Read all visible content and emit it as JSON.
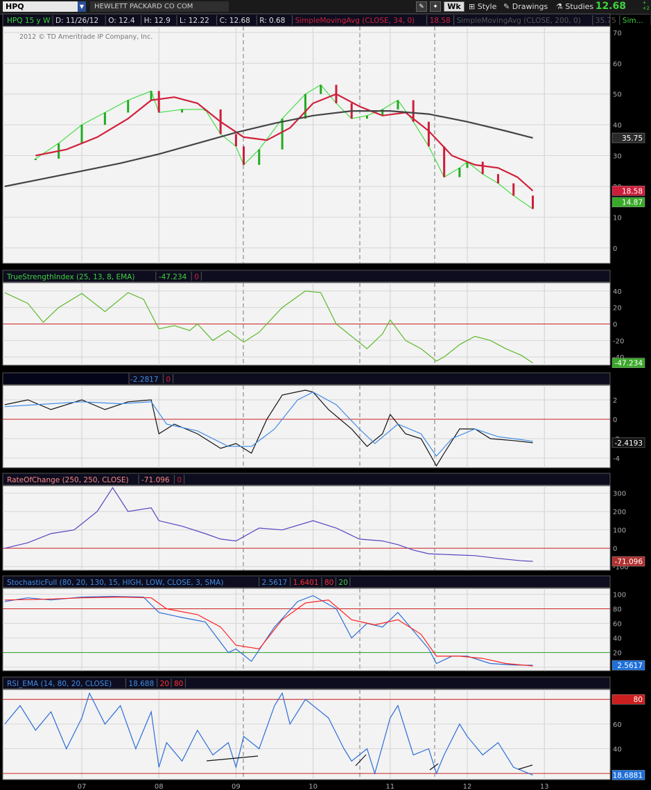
{
  "toolbar": {
    "symbol": "HPQ",
    "company": "HEWLETT PACKARD CO COM",
    "wk_label": "Wk",
    "style_label": "Style",
    "drawings_label": "Drawings",
    "studies_label": "Studies",
    "last_price": "12.68",
    "change_up": "+",
    "change_up2": "+2"
  },
  "price_panel": {
    "header": [
      {
        "text": "HPQ 15 y W",
        "color": "#3ed13e"
      },
      {
        "text": "D: 11/26/12",
        "color": "#dddddd"
      },
      {
        "text": "O: 12.4",
        "color": "#dddddd"
      },
      {
        "text": "H: 12.9",
        "color": "#dddddd"
      },
      {
        "text": "L: 12.22",
        "color": "#dddddd"
      },
      {
        "text": "C: 12.68",
        "color": "#dddddd"
      },
      {
        "text": "R: 0.68",
        "color": "#dddddd"
      },
      {
        "text": "SimpleMovingAvg (CLOSE, 34, 0)",
        "color": "#d0203a"
      },
      {
        "text": "18.58",
        "color": "#d0203a"
      },
      {
        "text": "SimpleMovingAvg (CLOSE, 200, 0)",
        "color": "#555555"
      },
      {
        "text": "35.75",
        "color": "#555555"
      },
      {
        "text": "Sim...",
        "color": "#3ed13e"
      }
    ],
    "copyright": "2012 © TD Ameritrade IP Company, Inc.",
    "badges": [
      {
        "text": "35.75",
        "bg": "#2a2a2a",
        "value": 35.75
      },
      {
        "text": "18.58",
        "bg": "#cc1e3a",
        "value": 18.58
      },
      {
        "text": "14.87",
        "bg": "#3aa82a",
        "value": 14.87
      }
    ]
  },
  "tsi_panel": {
    "header": [
      {
        "text": "TrueStrengthIndex (25, 13, 8, EMA)",
        "color": "#3ed13e"
      },
      {
        "text": "-47.234",
        "color": "#3ed13e"
      },
      {
        "text": "0",
        "color": "#d0203a"
      }
    ],
    "badge": "-47.234"
  },
  "macd_panel": {
    "header": [
      {
        "text": "-2.2817",
        "color": "#3f8ce6"
      },
      {
        "text": "0",
        "color": "#d0203a"
      }
    ],
    "badge": "-2.4193"
  },
  "roc_panel": {
    "header": [
      {
        "text": "RateOfChange (250, 250, CLOSE)",
        "color": "#ff8888"
      },
      {
        "text": "-71.096",
        "color": "#ff8888"
      },
      {
        "text": "0",
        "color": "#d0203a"
      }
    ],
    "badge": "-71.096"
  },
  "stoch_panel": {
    "header": [
      {
        "text": "StochasticFull (80, 20, 130, 15, HIGH, LOW, CLOSE, 3, SMA)",
        "color": "#3f8ce6"
      },
      {
        "text": "2.5617",
        "color": "#3f8ce6"
      },
      {
        "text": "1.6401",
        "color": "#ff3030"
      },
      {
        "text": "80",
        "color": "#ff3030"
      },
      {
        "text": "20",
        "color": "#3ed13e"
      }
    ],
    "badge": "2.5617"
  },
  "rsi_panel": {
    "header": [
      {
        "text": "RSI_EMA (14, 80, 20, CLOSE)",
        "color": "#3f8ce6"
      },
      {
        "text": "18.688",
        "color": "#3f8ce6"
      },
      {
        "text": "20",
        "color": "#ff3030"
      },
      {
        "text": "80",
        "color": "#ff3030"
      }
    ],
    "badges": [
      {
        "text": "80",
        "bg": "#cc1e1e",
        "value": 80
      },
      {
        "text": "18.6881",
        "bg": "#1e6fd9",
        "value": 18.688
      }
    ]
  },
  "chart_data": [
    {
      "type": "line",
      "title": "HPQ 15 y W",
      "x_ticks": [
        "07",
        "08",
        "09",
        "10",
        "11",
        "12",
        "13"
      ],
      "ylim": [
        -5,
        72
      ],
      "y_ticks": [
        0,
        10,
        20,
        30,
        40,
        50,
        60,
        70
      ],
      "series": [
        {
          "name": "HPQ",
          "color": "#44dd44",
          "x": [
            2006.4,
            2006.7,
            2007.0,
            2007.3,
            2007.6,
            2007.9,
            2008.0,
            2008.3,
            2008.6,
            2008.8,
            2009.0,
            2009.1,
            2009.3,
            2009.6,
            2009.9,
            2010.1,
            2010.3,
            2010.5,
            2010.7,
            2010.9,
            2011.1,
            2011.3,
            2011.5,
            2011.7,
            2011.9,
            2012.0,
            2012.2,
            2012.4,
            2012.6,
            2012.85
          ],
          "values": [
            29,
            34,
            40,
            44,
            48,
            51,
            44,
            45,
            45,
            37,
            33,
            27,
            32,
            42,
            50,
            53,
            47,
            42,
            43,
            45,
            48,
            41,
            33,
            23,
            26,
            28,
            24,
            21,
            17,
            12.68
          ]
        },
        {
          "name": "SimpleMovingAvg (CLOSE, 34, 0)",
          "color": "#d0203a",
          "x": [
            2006.4,
            2006.8,
            2007.2,
            2007.6,
            2007.9,
            2008.2,
            2008.5,
            2008.8,
            2009.1,
            2009.4,
            2009.7,
            2010.0,
            2010.3,
            2010.6,
            2010.9,
            2011.2,
            2011.5,
            2011.8,
            2012.1,
            2012.4,
            2012.65,
            2012.85
          ],
          "values": [
            30,
            32,
            36,
            42,
            48,
            49,
            47,
            41,
            36,
            35,
            39,
            47,
            50,
            46,
            43,
            44,
            38,
            30,
            27,
            26,
            23,
            18.58
          ]
        },
        {
          "name": "SimpleMovingAvg (CLOSE, 200, 0)",
          "color": "#444444",
          "x": [
            2006.0,
            2006.5,
            2007.0,
            2007.5,
            2008.0,
            2008.5,
            2009.0,
            2009.5,
            2010.0,
            2010.5,
            2011.0,
            2011.5,
            2012.0,
            2012.5,
            2012.85
          ],
          "values": [
            20,
            22.5,
            25,
            27.5,
            30.5,
            34,
            37.5,
            40.5,
            43,
            44.5,
            44.5,
            43.5,
            41,
            38,
            35.75
          ]
        }
      ]
    },
    {
      "type": "line",
      "title": "TrueStrengthIndex (25, 13, 8, EMA)",
      "ylim": [
        -50,
        50
      ],
      "y_ticks": [
        -40,
        -20,
        0,
        20,
        40
      ],
      "reference_line": 0,
      "series": [
        {
          "name": "TrueStrengthIndex",
          "color": "#5cb82a",
          "x": [
            2006.0,
            2006.3,
            2006.5,
            2006.7,
            2007.0,
            2007.3,
            2007.6,
            2007.8,
            2008.0,
            2008.2,
            2008.4,
            2008.5,
            2008.7,
            2008.9,
            2009.1,
            2009.3,
            2009.6,
            2009.9,
            2010.1,
            2010.3,
            2010.5,
            2010.7,
            2010.9,
            2011.0,
            2011.2,
            2011.4,
            2011.6,
            2011.7,
            2011.9,
            2012.1,
            2012.3,
            2012.5,
            2012.7,
            2012.85
          ],
          "values": [
            38,
            25,
            2,
            20,
            37,
            15,
            38,
            30,
            -6,
            -2,
            -8,
            0,
            -20,
            -8,
            -22,
            -10,
            20,
            40,
            38,
            0,
            -15,
            -30,
            -12,
            5,
            -20,
            -30,
            -45,
            -40,
            -25,
            -15,
            -20,
            -30,
            -38,
            -47.234
          ]
        }
      ]
    },
    {
      "type": "line",
      "ylim": [
        -5,
        3.5
      ],
      "y_ticks": [
        -4,
        -2,
        0,
        2
      ],
      "reference_line": 0,
      "series": [
        {
          "name": "",
          "color": "#111111",
          "x": [
            2006.0,
            2006.3,
            2006.6,
            2007.0,
            2007.3,
            2007.6,
            2007.9,
            2008.0,
            2008.2,
            2008.5,
            2008.8,
            2009.0,
            2009.2,
            2009.4,
            2009.6,
            2009.9,
            2010.0,
            2010.2,
            2010.5,
            2010.7,
            2010.9,
            2011.0,
            2011.2,
            2011.4,
            2011.6,
            2011.7,
            2011.9,
            2012.1,
            2012.3,
            2012.6,
            2012.85
          ],
          "values": [
            1.5,
            2.0,
            1.0,
            2.0,
            1.0,
            1.8,
            2.0,
            -1.5,
            -0.5,
            -1.5,
            -3.0,
            -2.5,
            -3.5,
            0,
            2.5,
            3.0,
            2.8,
            1.0,
            -1.0,
            -2.8,
            -1.5,
            0.5,
            -1.5,
            -2.0,
            -4.8,
            -3.5,
            -1.0,
            -1.0,
            -2.0,
            -2.2,
            -2.4193
          ]
        },
        {
          "name": "",
          "color": "#3f8ce6",
          "x": [
            2006.0,
            2006.4,
            2007.0,
            2007.5,
            2007.9,
            2008.1,
            2008.5,
            2008.9,
            2009.2,
            2009.5,
            2009.8,
            2010.0,
            2010.3,
            2010.6,
            2010.8,
            2011.1,
            2011.4,
            2011.6,
            2011.8,
            2012.1,
            2012.4,
            2012.7,
            2012.85
          ],
          "values": [
            1.3,
            1.5,
            1.8,
            1.6,
            1.8,
            -0.5,
            -1.2,
            -2.8,
            -2.8,
            -1.0,
            2.0,
            2.8,
            1.5,
            -1.0,
            -2.5,
            -0.5,
            -1.5,
            -3.8,
            -2.0,
            -1.0,
            -1.8,
            -2.1,
            -2.2817
          ]
        }
      ]
    },
    {
      "type": "line",
      "title": "RateOfChange (250, 250, CLOSE)",
      "ylim": [
        -120,
        340
      ],
      "y_ticks": [
        -100,
        0,
        100,
        200,
        300
      ],
      "reference_line": 0,
      "series": [
        {
          "name": "RateOfChange",
          "color": "#5a3fc0",
          "x": [
            2006.0,
            2006.3,
            2006.6,
            2006.9,
            2007.2,
            2007.4,
            2007.6,
            2007.9,
            2008.0,
            2008.3,
            2008.6,
            2008.8,
            2009.0,
            2009.3,
            2009.6,
            2010.0,
            2010.3,
            2010.6,
            2010.9,
            2011.1,
            2011.3,
            2011.5,
            2011.8,
            2012.1,
            2012.4,
            2012.7,
            2012.85
          ],
          "values": [
            0,
            30,
            80,
            100,
            200,
            330,
            200,
            220,
            150,
            120,
            80,
            50,
            40,
            110,
            100,
            150,
            110,
            50,
            40,
            20,
            -10,
            -30,
            -35,
            -40,
            -55,
            -68,
            -71.096
          ]
        }
      ]
    },
    {
      "type": "line",
      "title": "StochasticFull (80, 20, 130, 15, HIGH, LOW, CLOSE, 3, SMA)",
      "ylim": [
        -5,
        108
      ],
      "y_ticks": [
        0,
        20,
        40,
        60,
        80,
        100
      ],
      "reference_lines": [
        80,
        20
      ],
      "series": [
        {
          "name": "",
          "color": "#2a6cd8",
          "x": [
            2006.0,
            2006.3,
            2006.6,
            2007.0,
            2007.4,
            2007.8,
            2008.0,
            2008.3,
            2008.6,
            2008.9,
            2009.0,
            2009.2,
            2009.5,
            2009.8,
            2010.0,
            2010.3,
            2010.5,
            2010.7,
            2010.9,
            2011.1,
            2011.3,
            2011.5,
            2011.6,
            2011.8,
            2012.0,
            2012.3,
            2012.6,
            2012.85
          ],
          "values": [
            90,
            95,
            92,
            96,
            97,
            96,
            75,
            68,
            62,
            20,
            25,
            8,
            55,
            90,
            98,
            80,
            40,
            60,
            55,
            75,
            50,
            25,
            5,
            15,
            15,
            5,
            3,
            2.5617
          ]
        },
        {
          "name": "",
          "color": "#ff2020",
          "x": [
            2006.0,
            2006.5,
            2007.0,
            2007.5,
            2007.9,
            2008.1,
            2008.5,
            2008.8,
            2009.0,
            2009.3,
            2009.6,
            2009.9,
            2010.2,
            2010.5,
            2010.8,
            2011.1,
            2011.4,
            2011.6,
            2011.9,
            2012.2,
            2012.5,
            2012.85
          ],
          "values": [
            92,
            93,
            95,
            96,
            95,
            80,
            72,
            55,
            30,
            25,
            65,
            88,
            92,
            65,
            58,
            65,
            45,
            15,
            15,
            12,
            5,
            1.6401
          ]
        }
      ]
    },
    {
      "type": "line",
      "title": "RSI_EMA (14, 80, 20, CLOSE)",
      "ylim": [
        15,
        88
      ],
      "y_ticks": [
        40,
        60,
        80
      ],
      "reference_lines": [
        80,
        20
      ],
      "series": [
        {
          "name": "RSI_EMA",
          "color": "#2a6cd8",
          "x": [
            2006.0,
            2006.2,
            2006.4,
            2006.6,
            2006.8,
            2007.0,
            2007.1,
            2007.3,
            2007.5,
            2007.7,
            2007.9,
            2008.0,
            2008.1,
            2008.3,
            2008.5,
            2008.7,
            2008.9,
            2009.0,
            2009.1,
            2009.3,
            2009.5,
            2009.6,
            2009.7,
            2009.9,
            2010.0,
            2010.2,
            2010.4,
            2010.5,
            2010.7,
            2010.8,
            2011.0,
            2011.1,
            2011.3,
            2011.5,
            2011.6,
            2011.7,
            2011.9,
            2012.0,
            2012.2,
            2012.4,
            2012.6,
            2012.85
          ],
          "values": [
            60,
            75,
            55,
            70,
            40,
            65,
            85,
            60,
            75,
            40,
            70,
            25,
            45,
            30,
            55,
            35,
            45,
            25,
            50,
            40,
            75,
            85,
            60,
            80,
            75,
            65,
            40,
            30,
            40,
            20,
            65,
            75,
            35,
            40,
            20,
            35,
            60,
            50,
            35,
            45,
            25,
            18.688
          ]
        }
      ]
    }
  ]
}
